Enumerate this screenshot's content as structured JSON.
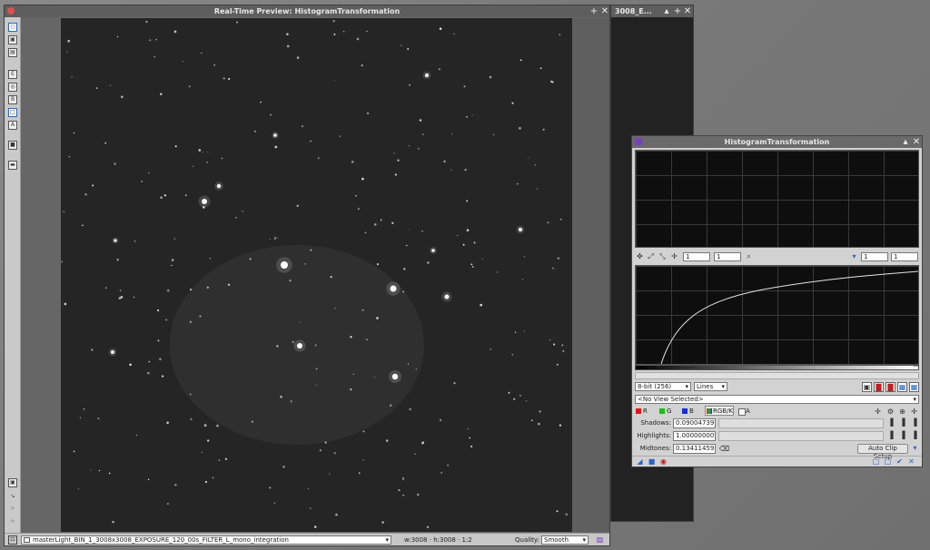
{
  "preview_window": {
    "title": "Real-Time Preview: HistogramTransformation",
    "status": {
      "view_name": "masterLight_BIN_1_3008x3008_EXPOSURE_120_00s_FILTER_L_mono_integration",
      "dimensions": "w:3008 · h:3008 · 1:2",
      "quality_label": "Quality:",
      "quality_value": "Smooth"
    }
  },
  "background_window": {
    "title": "3008_E..."
  },
  "histogram_dialog": {
    "title": "HistogramTransformation",
    "zoom": {
      "h1": "1",
      "v1": "1",
      "h2": "1",
      "v2": "1"
    },
    "resolution": "8-bit (256)",
    "graph_style": "Lines",
    "view_selector": "<No View Selected>",
    "channels": {
      "r": "R",
      "g": "G",
      "b": "B",
      "rgbk": "RGB/K",
      "a": "A"
    },
    "shadows_label": "Shadows:",
    "shadows_value": "0.09004739",
    "highlights_label": "Highlights:",
    "highlights_value": "1.00000000",
    "midtones_label": "Midtones:",
    "midtones_value": "0.13411459",
    "auto_clip_label": "Auto Clip Setup"
  },
  "colors": {
    "red": "#e01818",
    "green": "#18c018",
    "blue": "#1830d0",
    "accent": "#2a64c8"
  }
}
